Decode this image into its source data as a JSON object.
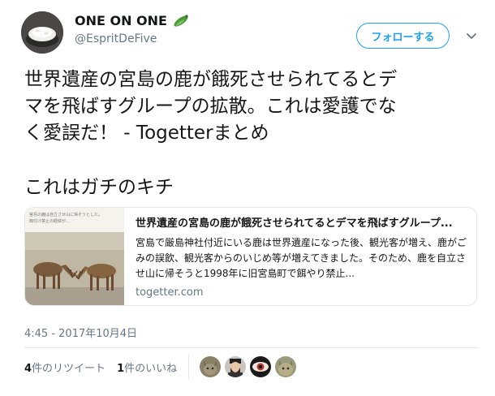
{
  "user": {
    "display_name": "ONE ON ONE",
    "handle": "@EspritDeFive",
    "emoji_icon": "cucumber-icon"
  },
  "follow_button": {
    "label": "フォローする"
  },
  "tweet": {
    "line1": "世界遺産の宮島の鹿が餓死させられてるとデ",
    "line2": "マを飛ばすグループの拡散。これは愛護でな",
    "line3": "く愛誤だ！ - Togetterまとめ",
    "line4": "これはガチのキチ"
  },
  "card": {
    "thumb_caption": "宮島の鹿は自立させ山に帰そうとした。\n餌付け禁止の経緯が…",
    "title": "世界遺産の宮島の鹿が餓死させられてるとデマを飛ばすグループ...",
    "description": "宮島で厳島神社付近にいる鹿は世界遺産になった後、観光客が増え、鹿がごみの誤飲、観光客からのいじめ等が増えてきました。そのため、鹿を自立させ山に帰そうと1998年に旧宮島町で餌やり禁止...",
    "domain": "togetter.com"
  },
  "timestamp": "4:45 - 2017年10月4日",
  "stats": {
    "retweet_count": "4",
    "retweet_label": "件のリツイート",
    "like_count": "1",
    "like_label": "件のいいね"
  },
  "colors": {
    "accent": "#1da1f2",
    "muted": "#657786",
    "border": "#e1e8ed"
  }
}
